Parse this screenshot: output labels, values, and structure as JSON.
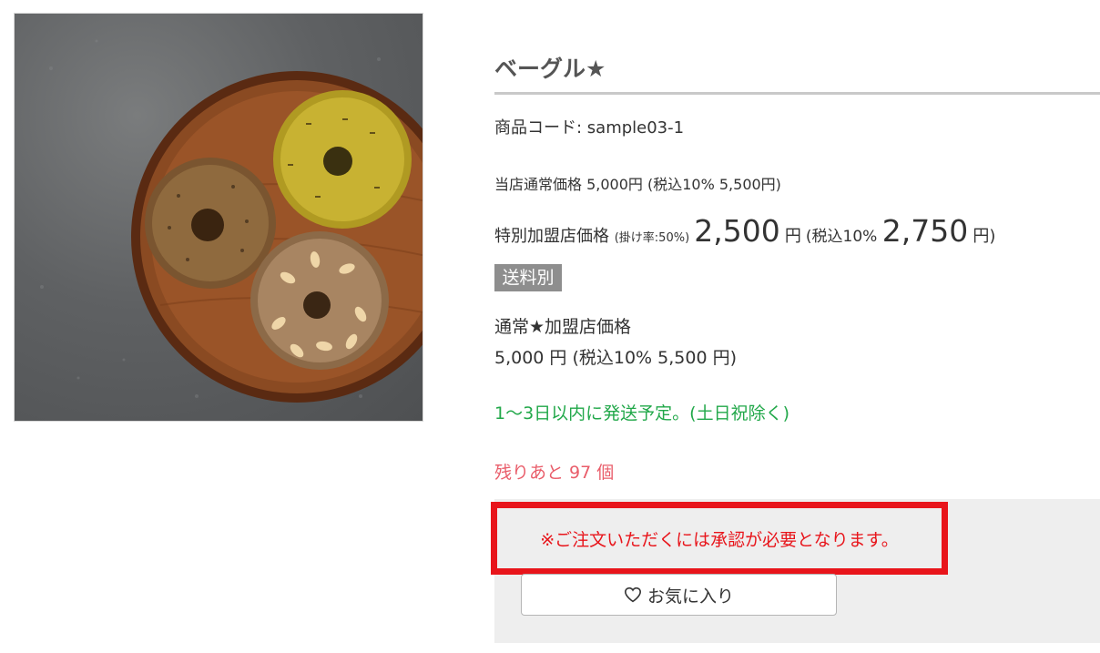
{
  "product": {
    "title": "ベーグル★",
    "code_text": "商品コード: sample03-1",
    "normal_price_text": "当店通常価格 5,000円 (税込10% 5,500円)",
    "special": {
      "label": "特別加盟店価格 ",
      "rate": "(掛け率:50%)",
      "price": "2,500",
      "unit": "円",
      "tax_prefix": "(税込10% ",
      "tax_price": "2,750",
      "tax_suffix": "円)"
    },
    "shipping_badge": "送料別",
    "member_label": "通常★加盟店価格",
    "member_price": "5,000 円 (税込10% 5,500 円)",
    "shipping_note": "1～3日以内に発送予定。(土日祝除く)",
    "stock_text": "残りあと 97 個",
    "notice_text": "※ご注文いただくには承認が必要となります。",
    "favorite_label": "お気に入り"
  },
  "colors": {
    "shipping_note": "#22a84a",
    "stock": "#e95d6a",
    "notice": "#e8151b",
    "badge": "#8e8e8e"
  },
  "icons": {
    "favorite": "heart-icon"
  }
}
